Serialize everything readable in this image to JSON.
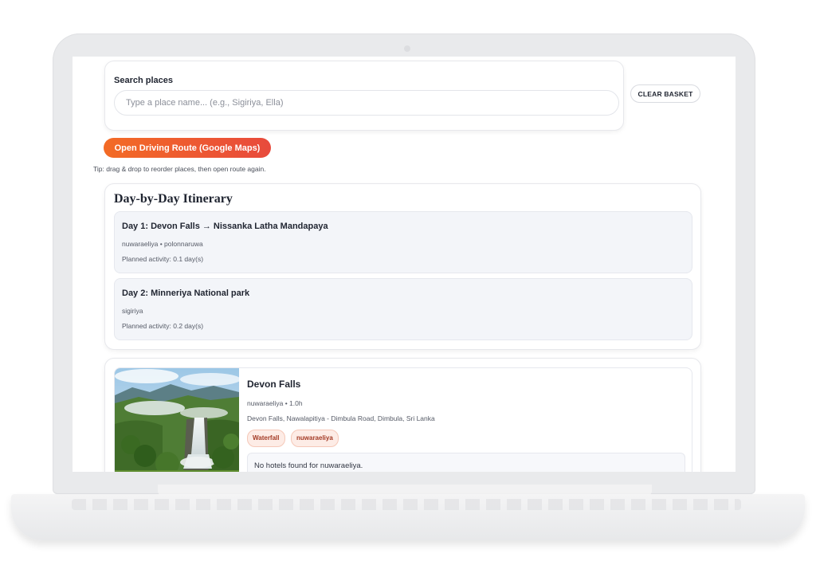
{
  "search": {
    "label": "Search places",
    "placeholder": "Type a place name... (e.g., Sigiriya, Ella)",
    "value": ""
  },
  "actions": {
    "clear_basket": "CLEAR BASKET",
    "open_route": "Open Driving Route (Google Maps)",
    "tip": "Tip: drag & drop to reorder places, then open route again."
  },
  "itinerary": {
    "title": "Day-by-Day Itinerary",
    "days": [
      {
        "title": "Day 1: Devon Falls → Nissanka Latha Mandapaya",
        "regions": "nuwaraeliya • polonnaruwa",
        "activity": "Planned activity: 0.1 day(s)"
      },
      {
        "title": "Day 2: Minneriya National park",
        "regions": "sigiriya",
        "activity": "Planned activity: 0.2 day(s)"
      }
    ]
  },
  "place": {
    "name": "Devon Falls",
    "meta": "nuwaraeliya • 1.0h",
    "address": "Devon Falls, Nawalapitiya - Dimbula Road, Dimbula, Sri Lanka",
    "tags": [
      "Waterfall",
      "nuwaraeliya"
    ],
    "hotels_message": "No hotels found for nuwaraeliya.",
    "image_icon": "waterfall-photo"
  },
  "colors": {
    "accent_start": "#f36b25",
    "accent_end": "#e84a3c",
    "tag_text": "#a33a25",
    "tag_bg": "#fdece6"
  }
}
